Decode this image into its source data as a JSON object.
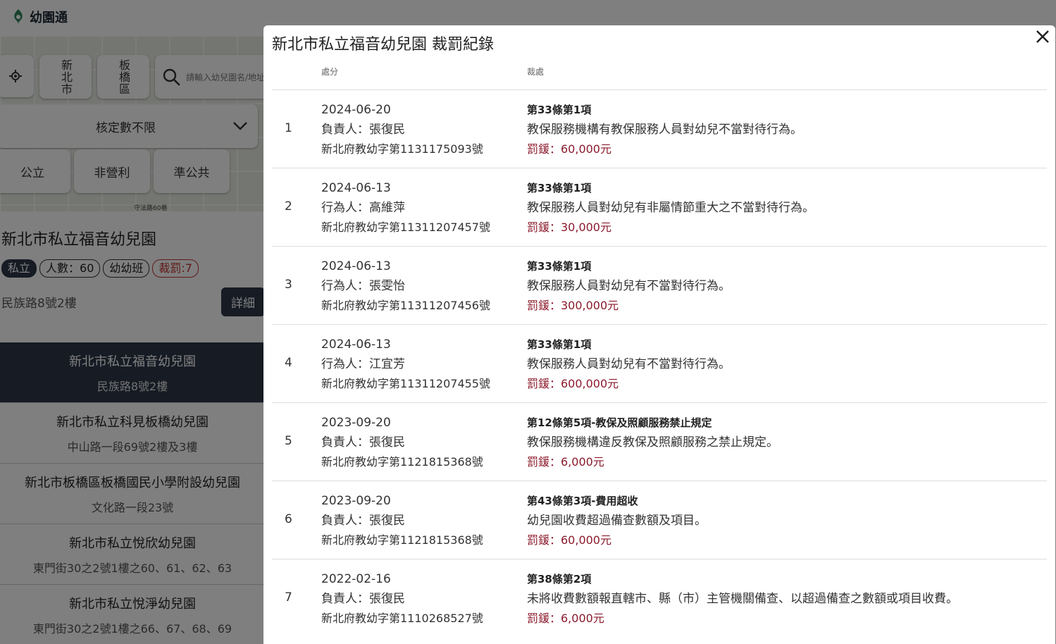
{
  "app": {
    "title": "幼園通"
  },
  "map": {
    "city_button": "新北市",
    "district_button": "板橋區",
    "search_placeholder": "請輸入幼兒園名/地址",
    "capacity_select": "核定數不限",
    "filters": [
      "公立",
      "非營利",
      "準公共"
    ],
    "map_label": "守法路60巷"
  },
  "info_card": {
    "name": "新北市私立福音幼兒園",
    "tags": {
      "type": "私立",
      "count": "人數：60",
      "class": "幼幼班",
      "penalty": "裁罰:7"
    },
    "address": "民族路8號2樓",
    "detail_button": "詳細"
  },
  "list": [
    {
      "name": "新北市私立福音幼兒園",
      "address": "民族路8號2樓"
    },
    {
      "name": "新北市私立科見板橋幼兒園",
      "address": "中山路一段69號2樓及3樓"
    },
    {
      "name": "新北市板橋區板橋國民小學附設幼兒園",
      "address": "文化路一段23號"
    },
    {
      "name": "新北市私立悅欣幼兒園",
      "address": "東門街30之2號1樓之60、61、62、63"
    },
    {
      "name": "新北市私立悅淨幼兒園",
      "address": "東門街30之2號1樓之66、67、68、69"
    }
  ],
  "modal": {
    "title": "新北市私立福音幼兒園 裁罰紀錄",
    "col_disposal": "處分",
    "col_penalty": "裁處",
    "records": [
      {
        "index": "1",
        "date": "2024-06-20",
        "person": "負責人：張復民",
        "doc": "新北府教幼字第1131175093號",
        "law": "第33條第1項",
        "desc": "教保服務機構有教保服務人員對幼兒不當對待行為。",
        "fine": "罰鍰：60,000元"
      },
      {
        "index": "2",
        "date": "2024-06-13",
        "person": "行為人：高維萍",
        "doc": "新北府教幼字第11311207457號",
        "law": "第33條第1項",
        "desc": "教保服務人員對幼兒有非屬情節重大之不當對待行為。",
        "fine": "罰鍰：30,000元"
      },
      {
        "index": "3",
        "date": "2024-06-13",
        "person": "行為人：張雯怡",
        "doc": "新北府教幼字第11311207456號",
        "law": "第33條第1項",
        "desc": "教保服務人員對幼兒有不當對待行為。",
        "fine": "罰鍰：300,000元"
      },
      {
        "index": "4",
        "date": "2024-06-13",
        "person": "行為人：江宜芳",
        "doc": "新北府教幼字第11311207455號",
        "law": "第33條第1項",
        "desc": "教保服務人員對幼兒有不當對待行為。",
        "fine": "罰鍰：600,000元"
      },
      {
        "index": "5",
        "date": "2023-09-20",
        "person": "負責人：張復民",
        "doc": "新北府教幼字第1121815368號",
        "law": "第12條第5項-教保及照顧服務禁止規定",
        "desc": "教保服務機構違反教保及照顧服務之禁止規定。",
        "fine": "罰鍰：6,000元"
      },
      {
        "index": "6",
        "date": "2023-09-20",
        "person": "負責人：張復民",
        "doc": "新北府教幼字第1121815368號",
        "law": "第43條第3項-費用超收",
        "desc": "幼兒園收費超過備查數額及項目。",
        "fine": "罰鍰：60,000元"
      },
      {
        "index": "7",
        "date": "2022-02-16",
        "person": "負責人：張復民",
        "doc": "新北府教幼字第1110268527號",
        "law": "第38條第2項",
        "desc": "未將收費數額報直轄市、縣（市）主管機關備查、以超過備查之數額或項目收費。",
        "fine": "罰鍰：6,000元"
      }
    ]
  }
}
